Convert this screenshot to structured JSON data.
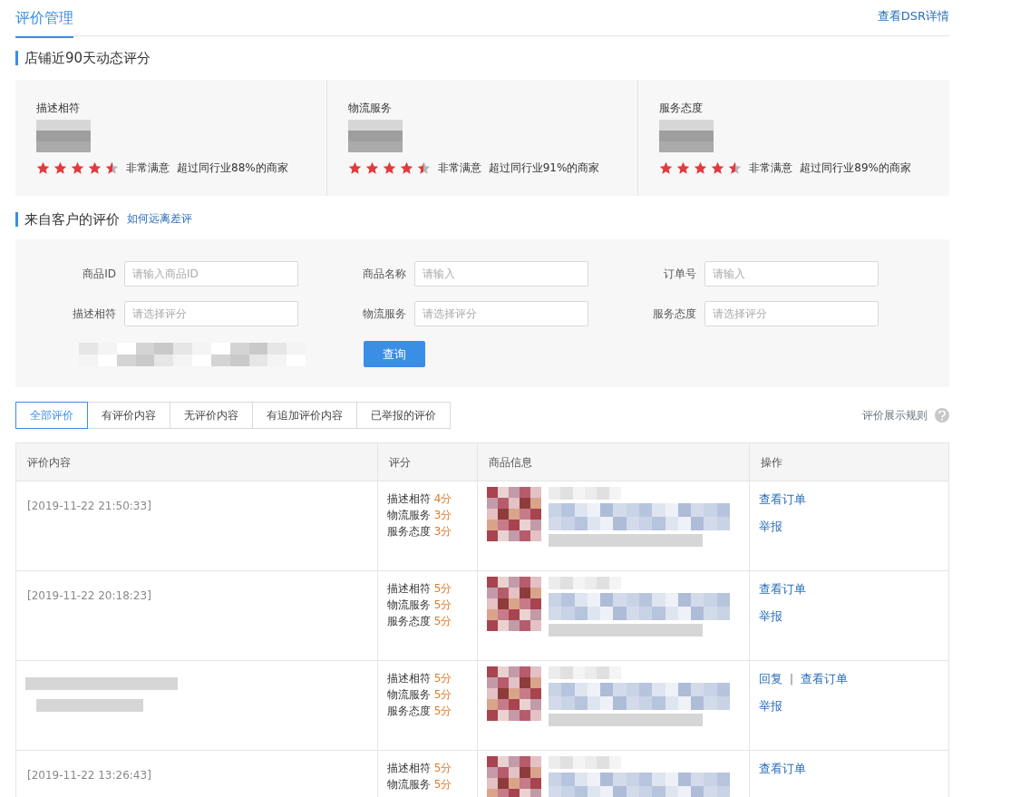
{
  "header": {
    "title": "评价管理",
    "link": "查看DSR详情"
  },
  "dsr": {
    "title": "店铺近90天动态评分",
    "items": [
      {
        "label": "描述相符",
        "stars": 4.5,
        "verdict": "非常满意",
        "compare": "超过同行业88%的商家"
      },
      {
        "label": "物流服务",
        "stars": 4.5,
        "verdict": "非常满意",
        "compare": "超过同行业91%的商家"
      },
      {
        "label": "服务态度",
        "stars": 4.5,
        "verdict": "非常满意",
        "compare": "超过同行业89%的商家"
      }
    ]
  },
  "reviews": {
    "title": "来自客户的评价",
    "help_link": "如何远离差评"
  },
  "filters": {
    "fields": [
      {
        "label": "商品ID",
        "placeholder": "请输入商品ID"
      },
      {
        "label": "商品名称",
        "placeholder": "请输入"
      },
      {
        "label": "订单号",
        "placeholder": "请输入"
      },
      {
        "label": "描述相符",
        "placeholder": "请选择评分"
      },
      {
        "label": "物流服务",
        "placeholder": "请选择评分"
      },
      {
        "label": "服务态度",
        "placeholder": "请选择评分"
      }
    ],
    "button": "查询"
  },
  "tabs": [
    {
      "label": "全部评价",
      "selected": true
    },
    {
      "label": "有评价内容",
      "selected": false
    },
    {
      "label": "无评价内容",
      "selected": false
    },
    {
      "label": "有追加评价内容",
      "selected": false
    },
    {
      "label": "已举报的评价",
      "selected": false
    }
  ],
  "rules_link": "评价展示规则",
  "table": {
    "columns": [
      "评价内容",
      "评分",
      "商品信息",
      "操作"
    ],
    "separator": "|",
    "rows": [
      {
        "time": "[2019-11-22 21:50:33]",
        "blurred_comment": false,
        "ratings": [
          {
            "label": "描述相符",
            "score": "4分"
          },
          {
            "label": "物流服务",
            "score": "3分"
          },
          {
            "label": "服务态度",
            "score": "3分"
          }
        ],
        "actions": [
          [
            "查看订单"
          ],
          [
            "举报"
          ]
        ]
      },
      {
        "time": "[2019-11-22 20:18:23]",
        "blurred_comment": false,
        "ratings": [
          {
            "label": "描述相符",
            "score": "5分"
          },
          {
            "label": "物流服务",
            "score": "5分"
          },
          {
            "label": "服务态度",
            "score": "5分"
          }
        ],
        "actions": [
          [
            "查看订单"
          ],
          [
            "举报"
          ]
        ]
      },
      {
        "blurred_comment": true,
        "ratings": [
          {
            "label": "描述相符",
            "score": "5分"
          },
          {
            "label": "物流服务",
            "score": "5分"
          },
          {
            "label": "服务态度",
            "score": "5分"
          }
        ],
        "actions": [
          [
            "回复",
            "查看订单"
          ],
          [
            "举报"
          ]
        ]
      },
      {
        "time": "[2019-11-22 13:26:43]",
        "blurred_comment": false,
        "ratings": [
          {
            "label": "描述相符",
            "score": "5分"
          },
          {
            "label": "物流服务",
            "score": "5分"
          }
        ],
        "actions": [
          [
            "查看订单"
          ]
        ]
      }
    ]
  }
}
